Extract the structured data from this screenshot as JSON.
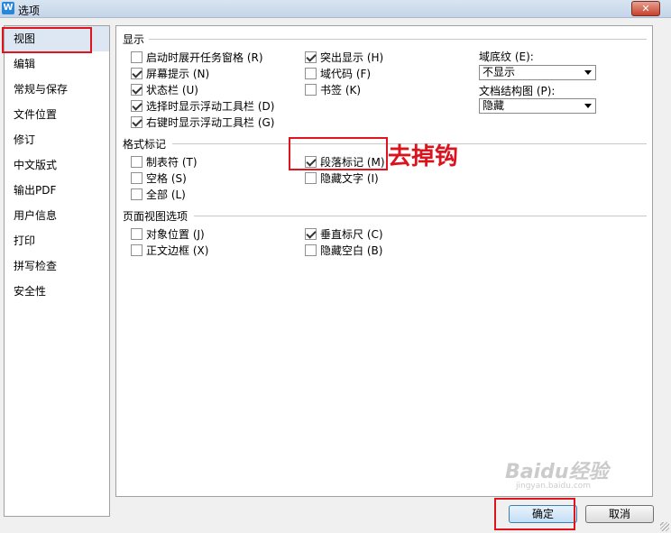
{
  "window": {
    "title": "选项",
    "app_icon": "wps-writer-icon",
    "close_label": "✕"
  },
  "sidebar": {
    "items": [
      {
        "label": "视图",
        "selected": true
      },
      {
        "label": "编辑"
      },
      {
        "label": "常规与保存"
      },
      {
        "label": "文件位置"
      },
      {
        "label": "修订"
      },
      {
        "label": "中文版式"
      },
      {
        "label": "输出PDF"
      },
      {
        "label": "用户信息"
      },
      {
        "label": "打印"
      },
      {
        "label": "拼写检查"
      },
      {
        "label": "安全性"
      }
    ]
  },
  "display_section": {
    "header": "显示",
    "left_options": [
      {
        "label": "启动时展开任务窗格 (R)",
        "checked": false
      },
      {
        "label": "屏幕提示 (N)",
        "checked": true
      },
      {
        "label": "状态栏 (U)",
        "checked": true
      },
      {
        "label": "选择时显示浮动工具栏 (D)",
        "checked": true
      },
      {
        "label": "右键时显示浮动工具栏 (G)",
        "checked": true
      }
    ],
    "mid_options": [
      {
        "label": "突出显示 (H)",
        "checked": true
      },
      {
        "label": "域代码 (F)",
        "checked": false
      },
      {
        "label": "书签 (K)",
        "checked": false
      }
    ],
    "field_shading_label": "域底纹 (E):",
    "field_shading_value": "不显示",
    "doc_map_label": "文档结构图 (P):",
    "doc_map_value": "隐藏"
  },
  "format_marks_section": {
    "header": "格式标记",
    "left_options": [
      {
        "label": "制表符 (T)",
        "checked": false
      },
      {
        "label": "空格 (S)",
        "checked": false
      },
      {
        "label": "全部 (L)",
        "checked": false
      }
    ],
    "mid_options": [
      {
        "label": "段落标记 (M)",
        "checked": true
      },
      {
        "label": "隐藏文字 (I)",
        "checked": false
      }
    ]
  },
  "page_view_section": {
    "header": "页面视图选项",
    "left_options": [
      {
        "label": "对象位置 (J)",
        "checked": false
      },
      {
        "label": "正文边框 (X)",
        "checked": false
      }
    ],
    "mid_options": [
      {
        "label": "垂直标尺 (C)",
        "checked": true
      },
      {
        "label": "隐藏空白 (B)",
        "checked": false
      }
    ]
  },
  "buttons": {
    "ok_label": "确定",
    "cancel_label": "取消"
  },
  "annotation": {
    "text": "去掉钩",
    "color": "#e0141e"
  },
  "watermark": {
    "text": "Baidu经验",
    "sub": "jingyan.baidu.com"
  }
}
